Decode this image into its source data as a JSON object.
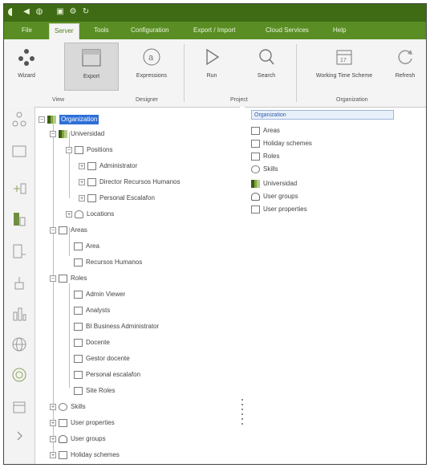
{
  "menu": {
    "items": [
      "File",
      "Server",
      "Tools",
      "Configuration",
      "Export / Import",
      "Cloud Services",
      "Help"
    ],
    "active_index": 1
  },
  "ribbon": {
    "buttons": {
      "wizard": "Wizard",
      "export": "Export",
      "expressions": "Expressions",
      "run": "Run",
      "search": "Search",
      "working_time": "Working Time Scheme",
      "refresh": "Refresh"
    },
    "groups": {
      "view": "View",
      "designer": "Designer",
      "project": "Project",
      "organization": "Organization"
    }
  },
  "tree": {
    "root": "Organization",
    "universidad": "Universidad",
    "positions": "Positions",
    "pos_items": [
      "Administrator",
      "Director Recursos Humanos",
      "Personal Escalafon"
    ],
    "locations": "Locations",
    "areas": "Areas",
    "area_items": [
      "Area",
      "Recursos Humanos"
    ],
    "roles": "Roles",
    "role_items": [
      "Admin Viewer",
      "Analysts",
      "BI Business Administrator",
      "Docente",
      "Gestor docente",
      "Personal escalafon",
      "Site Roles"
    ],
    "skills": "Skills",
    "user_properties": "User properties",
    "user_groups": "User groups",
    "holiday_schemes": "Holiday schemes"
  },
  "right_panel": {
    "header": "Organization",
    "items": [
      "Areas",
      "Holiday schemes",
      "Roles",
      "Skills",
      "Universidad",
      "User groups",
      "User properties"
    ]
  },
  "colors": {
    "title_green": "#3f6b15",
    "menu_green": "#5a8e24",
    "selection_blue": "#2e6fd8"
  }
}
